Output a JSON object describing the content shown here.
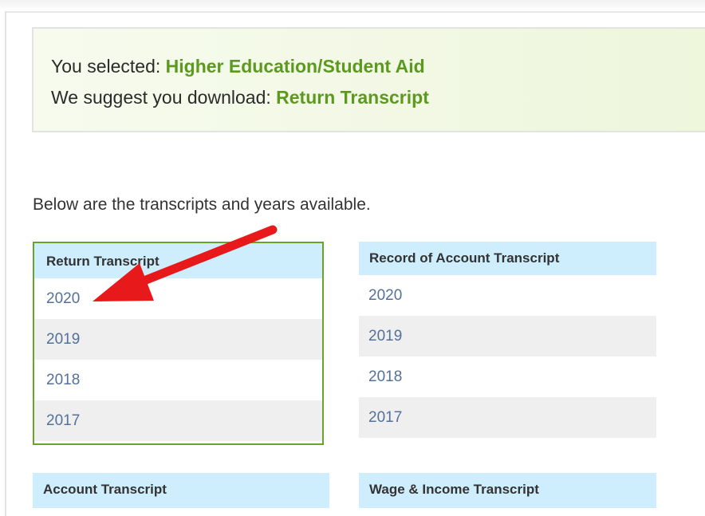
{
  "selection": {
    "selected_prefix": "You selected:",
    "selected_value": "Higher Education/Student Aid",
    "suggest_prefix": "We suggest you download:",
    "suggest_value": "Return Transcript"
  },
  "intro_text": "Below are the transcripts and years available.",
  "transcripts": {
    "return": {
      "title": "Return Transcript",
      "years": [
        "2020",
        "2019",
        "2018",
        "2017"
      ]
    },
    "record_of_account": {
      "title": "Record of Account Transcript",
      "years": [
        "2020",
        "2019",
        "2018",
        "2017"
      ]
    },
    "account": {
      "title": "Account Transcript"
    },
    "wage_income": {
      "title": "Wage & Income Transcript"
    }
  },
  "colors": {
    "highlight_green": "#5b9a1e",
    "header_blue": "#cfeefd",
    "link_blue": "#53719a",
    "arrow_red": "#e8191b"
  },
  "annotation": {
    "arrow_icon": "red-arrow-icon"
  }
}
